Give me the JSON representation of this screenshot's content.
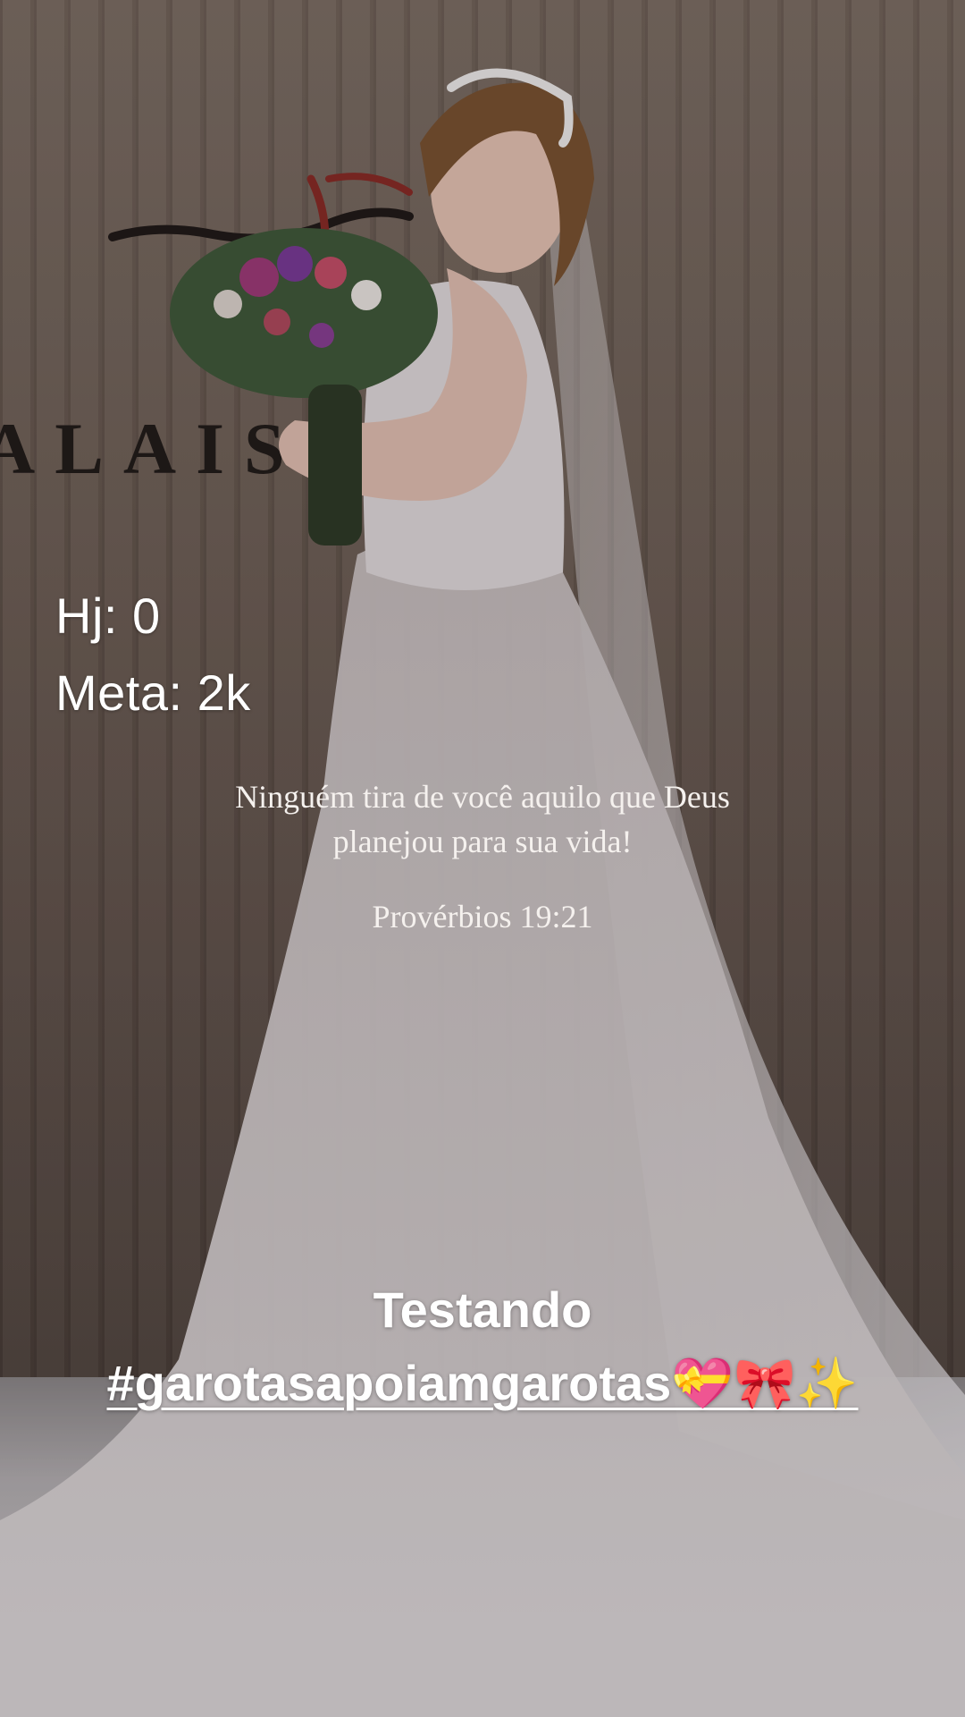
{
  "overlay": {
    "today_counter": "Hj: 0",
    "goal_counter": "Meta: 2k"
  },
  "verse": {
    "line1": "Ninguém tira de você aquilo que Deus",
    "line2": "planejou para sua vida!",
    "reference": "Provérbios 19:21"
  },
  "caption": {
    "title": "Testando",
    "hashtag": "#garotasapoiamgarotas💝🎀✨"
  },
  "background": {
    "wall_lettering": "ALAIS RES",
    "icons": [
      "bride-photo",
      "bouquet-icon",
      "veil-icon",
      "tiara-icon"
    ]
  }
}
